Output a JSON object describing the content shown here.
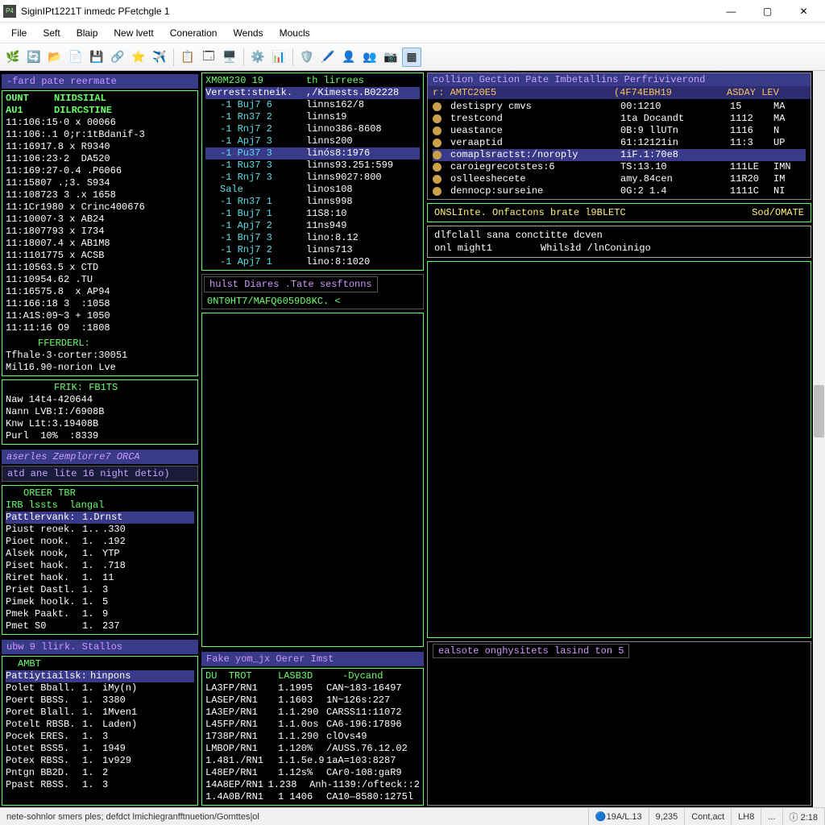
{
  "window": {
    "title": "SiginIPt1221T inmedc PFetchgle 1"
  },
  "menus": [
    "File",
    "Seft",
    "Blaip",
    "New lvett",
    "Coneration",
    "Wends",
    "Moucls"
  ],
  "left": {
    "tab_label": "-fard pate reermate",
    "hdr_a": "OUNT",
    "hdr_b": "NIIDSIIAL",
    "hdr_c": "AU1",
    "hdr_d": "DILRCSTINE",
    "rows": [
      "11:106:15·0 x 00066",
      "11:106:.1 0;r:1tBdanif-3",
      "11:16917.8 x R9340",
      "11:106:23·2  DA520",
      "11:169:27-0.4 .P6066",
      "11:15807 .;3. S934",
      "11:108723 3 .x 1658",
      "11:1Cr1980 x Crinc400676",
      "11:10007·3 x AB24",
      "11:1807793 x I734",
      "11:18007.4 x AB1M8",
      "11:1101775 x ACSB",
      "11:10563.5 x CTD",
      "11:10954.62 .TU",
      "11:16575.8  x AP94",
      "11:166:18 3  :1058",
      "11:A1S:09~3 + 1050",
      "11:11:16 O9  :1808"
    ],
    "summary_hdr": "FFERDERL:",
    "summary1": "Tfhale·3·corter:30051",
    "summary2": "Mil16.90-norion Lve",
    "frik": "FRIK: FB1TS",
    "info_rows": [
      "Naw 14t4-420644",
      "Nann LVB:I:/6908B",
      "Knw L1t:3.19408B",
      "Purl  10%  :8339"
    ],
    "section2_band": "aserles  Zemplorre7  ORCA",
    "section2_header": "atd ane lite 16 night detio)",
    "order_hdr": "OREER TBR",
    "irb_hdr": "IRB lssts  langal",
    "order_sel": {
      "a": "Pattlervank:",
      "b": "1.Drnst"
    },
    "order_rows": [
      [
        "Piust reoek.",
        "1..",
        ".330"
      ],
      [
        "Pioet nook.",
        "1.",
        ".192"
      ],
      [
        "Alsek nook,",
        "1.",
        "YTP"
      ],
      [
        "Piset haok.",
        "1.",
        ".718"
      ],
      [
        "Riret haok.",
        "1.",
        "11"
      ],
      [
        "Priet Dastl.",
        "1.",
        "3"
      ],
      [
        "Pimek hoolk.",
        "1.",
        "5"
      ],
      [
        "Pmek Paakt.",
        "1.",
        "9"
      ],
      [
        "Pmet S0",
        "1.",
        "237"
      ]
    ],
    "section3_band": "ubw 9 llirk. Stallos",
    "amt_hdr": "AMBT",
    "amt_sel": {
      "a": "Pattiytiailsk:",
      "b": "hinpons"
    },
    "amt_rows": [
      [
        "Polet Bball.",
        "1.",
        "iMy(n)"
      ],
      [
        "Poert BBSS.",
        "1.",
        "3380"
      ],
      [
        "Poret Blall.",
        "1.",
        "1Mven1"
      ],
      [
        "Potelt RBSB.",
        "1.",
        "Laden)"
      ],
      [
        "Pocek ERES.",
        "1.",
        "3"
      ],
      [
        "Lotet BSS5.",
        "1.",
        "1949"
      ],
      [
        "Potex RBSS.",
        "1.",
        "1v929"
      ],
      [
        "Pntgn BB2D.",
        "1.",
        "2"
      ],
      [
        "Ppast RBSS.",
        "1.",
        "3"
      ]
    ]
  },
  "mid": {
    "top_hdr_left": "XM0M230 19",
    "top_hdr_right": "th lirrees",
    "top_sel": {
      "a": "Verrest:stneik.",
      "b": ",/Kimests.B02228"
    },
    "top_rows": [
      [
        "-1 Buj7 6",
        "linns162/8"
      ],
      [
        "-1 Rn37 2",
        "linns19"
      ],
      [
        "-1 Rnj7 2",
        "linno386-8608"
      ],
      [
        "-1 Apj7 3",
        "linns200"
      ],
      [
        "-1 Pu37 3",
        "linós8:1976"
      ],
      [
        "-1 Ru37 3",
        "linns93.251:599"
      ],
      [
        "-1 Rnj7 3",
        "linns9027:800"
      ],
      [
        "Sale",
        "linos108"
      ],
      [
        "-1 Rn37 1",
        "linns998"
      ],
      [
        "-1 Buj7 1",
        "11S8:10"
      ],
      [
        "-1 Apj7 2",
        "11ns949"
      ],
      [
        "-1 Bnj7 3",
        "lino:8.12"
      ],
      [
        "-1 Rnj7 2",
        "linns713"
      ],
      [
        "-1 Apj7 1",
        "lino:8:1020"
      ]
    ],
    "sessions_band": "hulst Diares .Tate sesftonns",
    "sessions_line": "0NT0HT7/MAFQ6059D8KC. <",
    "bottom_band": "Fake yom_jx  Oerer Imst",
    "bottom_hdr": [
      "DU  TROT",
      "LASB3D",
      "-Dycand"
    ],
    "bottom_rows": [
      [
        "LA3FP/RN1",
        "1.1995",
        "CAN~183-16497"
      ],
      [
        "LASEP/RN1",
        "1.1603",
        "1N~126s:227"
      ],
      [
        "1A3EP/RN1",
        "1.1.290",
        "CARSS11:11072"
      ],
      [
        "L45FP/RN1",
        "1.1.0os",
        "CA6-196:17896"
      ],
      [
        "1738P/RN1",
        "1.1.290",
        "clOvs49"
      ],
      [
        "LMBOP/RN1",
        "1.120%",
        "/AUSS.76.12.02"
      ],
      [
        "1.481./RN1",
        "1.1.5e.9",
        "1aA=103:8287"
      ],
      [
        "L48EP/RN1",
        "1.12s%",
        "CAr0-108:gaR9"
      ],
      [
        "14A8EP/RN1",
        "1.238",
        "Anh-1139:/ofteck::2"
      ],
      [
        "1.4A0B/RN1",
        "1 1406",
        "CA10—8580:1275l"
      ]
    ]
  },
  "right": {
    "top_hdr": "collion Gection Pate Imbetallins Perfriviverond",
    "subhdr_a": "r: AMTC20E5",
    "subhdr_b": "(4F74EBH19",
    "subhdr_c": "ASDAY  LEV",
    "rows": [
      [
        "destispry cmvs",
        "00:1210",
        "15",
        "MA"
      ],
      [
        "trestcond",
        "1ta Docandt",
        "1112",
        "MA"
      ],
      [
        "ueastance",
        "0B:9 llUTn",
        "1116",
        "N"
      ],
      [
        "veraaptid",
        "61:12121in",
        "11:3",
        "UP"
      ],
      [
        "comaplsractst:/noroply",
        "1iF.1:70e8",
        "",
        ""
      ],
      [
        "caroiegrecotstes:6",
        "TS:13.10",
        "111LE",
        "IMN"
      ],
      [
        "oslleeshecete",
        "amy.84cen",
        "11R20",
        "IM"
      ],
      [
        "dennocp:surseine",
        "0G:2 1.4",
        "1111C",
        "NI"
      ]
    ],
    "ons_left": "ONSLInte. Onfactons brate l9BLETC",
    "ons_right": "Sod/OMATE",
    "cmd1": "dlfclall sana conctitte dcven",
    "cmd2a": "onl might1",
    "cmd2b": "Whilsłd /lnConinigo",
    "bottom_band": "ealsote onghysitets lasind ton 5"
  },
  "status": {
    "left": "nete-sohnlor smers ples; defdct lmichiegranfftnuetion/Gomttes|ol",
    "cells": [
      "19A/L.13",
      "9,235",
      "Cont,act",
      "LH8",
      "...",
      "ⓘ 2:18"
    ]
  }
}
